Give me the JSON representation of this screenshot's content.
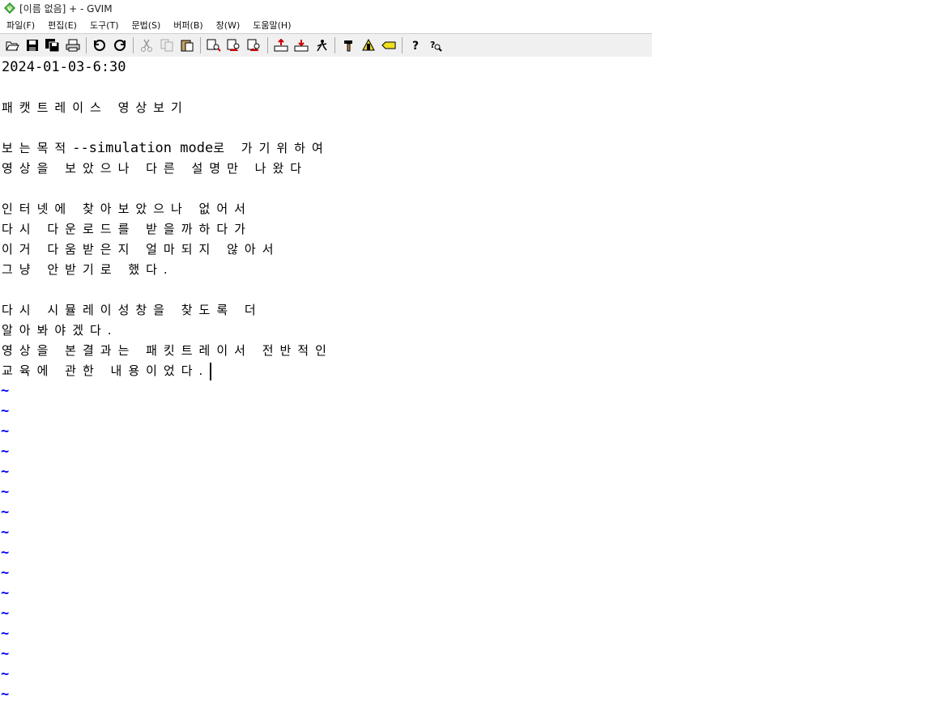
{
  "window": {
    "title": "[이름 없음] + - GVIM"
  },
  "menu": [
    {
      "key": "file",
      "label": "파일(F)"
    },
    {
      "key": "edit",
      "label": "편집(E)"
    },
    {
      "key": "tools",
      "label": "도구(T)"
    },
    {
      "key": "syntax",
      "label": "문법(S)"
    },
    {
      "key": "buffers",
      "label": "버퍼(B)"
    },
    {
      "key": "window",
      "label": "창(W)"
    },
    {
      "key": "help",
      "label": "도움말(H)"
    }
  ],
  "toolbar_icons": [
    "open-icon",
    "save-icon",
    "save-all-icon",
    "print-icon",
    "undo-icon",
    "redo-icon",
    "cut-icon",
    "copy-icon",
    "paste-icon",
    "find-replace-icon",
    "find-next-icon",
    "find-prev-icon",
    "load-session-icon",
    "save-session-icon",
    "run-script-icon",
    "make-icon",
    "shell-icon",
    "tags-icon",
    "help-icon",
    "find-help-icon"
  ],
  "editor": {
    "lines": {
      "l0": "2024-01-03-6:30",
      "l1": "",
      "l2": "패캣트레이스 영상보기",
      "l3": "",
      "l4a": "보는목적",
      "l4b": "--simulation mode",
      "l4c": "로 가기위하여",
      "l5": "영상을 보았으나 다른 설명만 나왔다",
      "l6": "",
      "l7": "인터넷에 찾아보았으나 없어서",
      "l8": "다시 다운로드를 받을까하다가",
      "l9": "이거 다움받은지 얼마되지 않아서",
      "l10": "그냥 안받기로 했다.",
      "l11": "",
      "l12": "다시 시뮬레이성창을 찾도록 더",
      "l13": "알아봐야겠다.",
      "l14": "영상을 본결과는 패킷트레이서 전반적인",
      "l15": "교육에 관한 내용이었다."
    },
    "tilde": "~"
  },
  "colors": {
    "tilde": "#0000ff",
    "toolbar_bg": "#f0f0f0"
  }
}
